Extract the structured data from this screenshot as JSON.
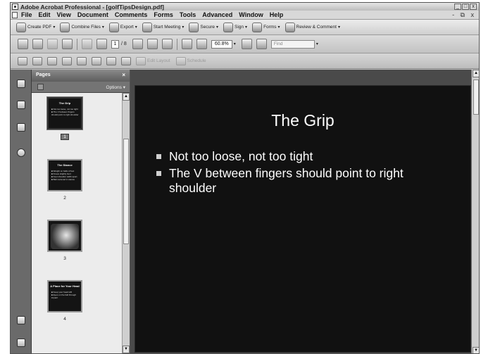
{
  "window": {
    "title": "Adobe Acrobat Professional - [golfTipsDesign.pdf]",
    "controls": [
      "_",
      "□",
      "x"
    ],
    "doc_controls": "- ⧉ x"
  },
  "menu": [
    "File",
    "Edit",
    "View",
    "Document",
    "Comments",
    "Forms",
    "Tools",
    "Advanced",
    "Window",
    "Help"
  ],
  "toolbar1": [
    {
      "label": "Create PDF",
      "icon": "create-pdf-icon"
    },
    {
      "label": "Combine Files",
      "icon": "combine-files-icon"
    },
    {
      "label": "Export",
      "icon": "export-icon"
    },
    {
      "label": "Start Meeting",
      "icon": "meeting-icon"
    },
    {
      "label": "Secure",
      "icon": "lock-icon"
    },
    {
      "label": "Sign",
      "icon": "pen-icon"
    },
    {
      "label": "Forms",
      "icon": "forms-icon"
    },
    {
      "label": "Review & Comment",
      "icon": "review-icon"
    }
  ],
  "toolbar2": {
    "current_page": "1",
    "page_total": "/ 8",
    "zoom": "60.8%",
    "find_placeholder": "Find"
  },
  "toolbar3": {
    "edit_layout": "Edit Layout",
    "schedule": "Schedule"
  },
  "pages_panel": {
    "title": "Pages",
    "close": "×",
    "options": "Options ▾",
    "thumbnails": [
      {
        "number": "1",
        "title": "The Grip",
        "body": "■ Not too loose, not too tight\n■ The V between fingers should point to right shoulder",
        "selected": true
      },
      {
        "number": "2",
        "title": "The Stance",
        "body": "■ Weight on balls of feet\n■ Knees slightly bent\n■ Feet shoulder width apart\n■ Ball centered in stance",
        "selected": false
      },
      {
        "number": "3",
        "title": "",
        "body": "",
        "photo": true,
        "selected": false
      },
      {
        "number": "4",
        "title": "A Place for Your Head",
        "body": "■ Keep your head still\n■ Eyes on the ball through impact",
        "selected": false
      }
    ]
  },
  "slide": {
    "title": "The Grip",
    "bullets": [
      "Not too loose, not too tight",
      "The V between fingers should point to right shoulder"
    ]
  }
}
